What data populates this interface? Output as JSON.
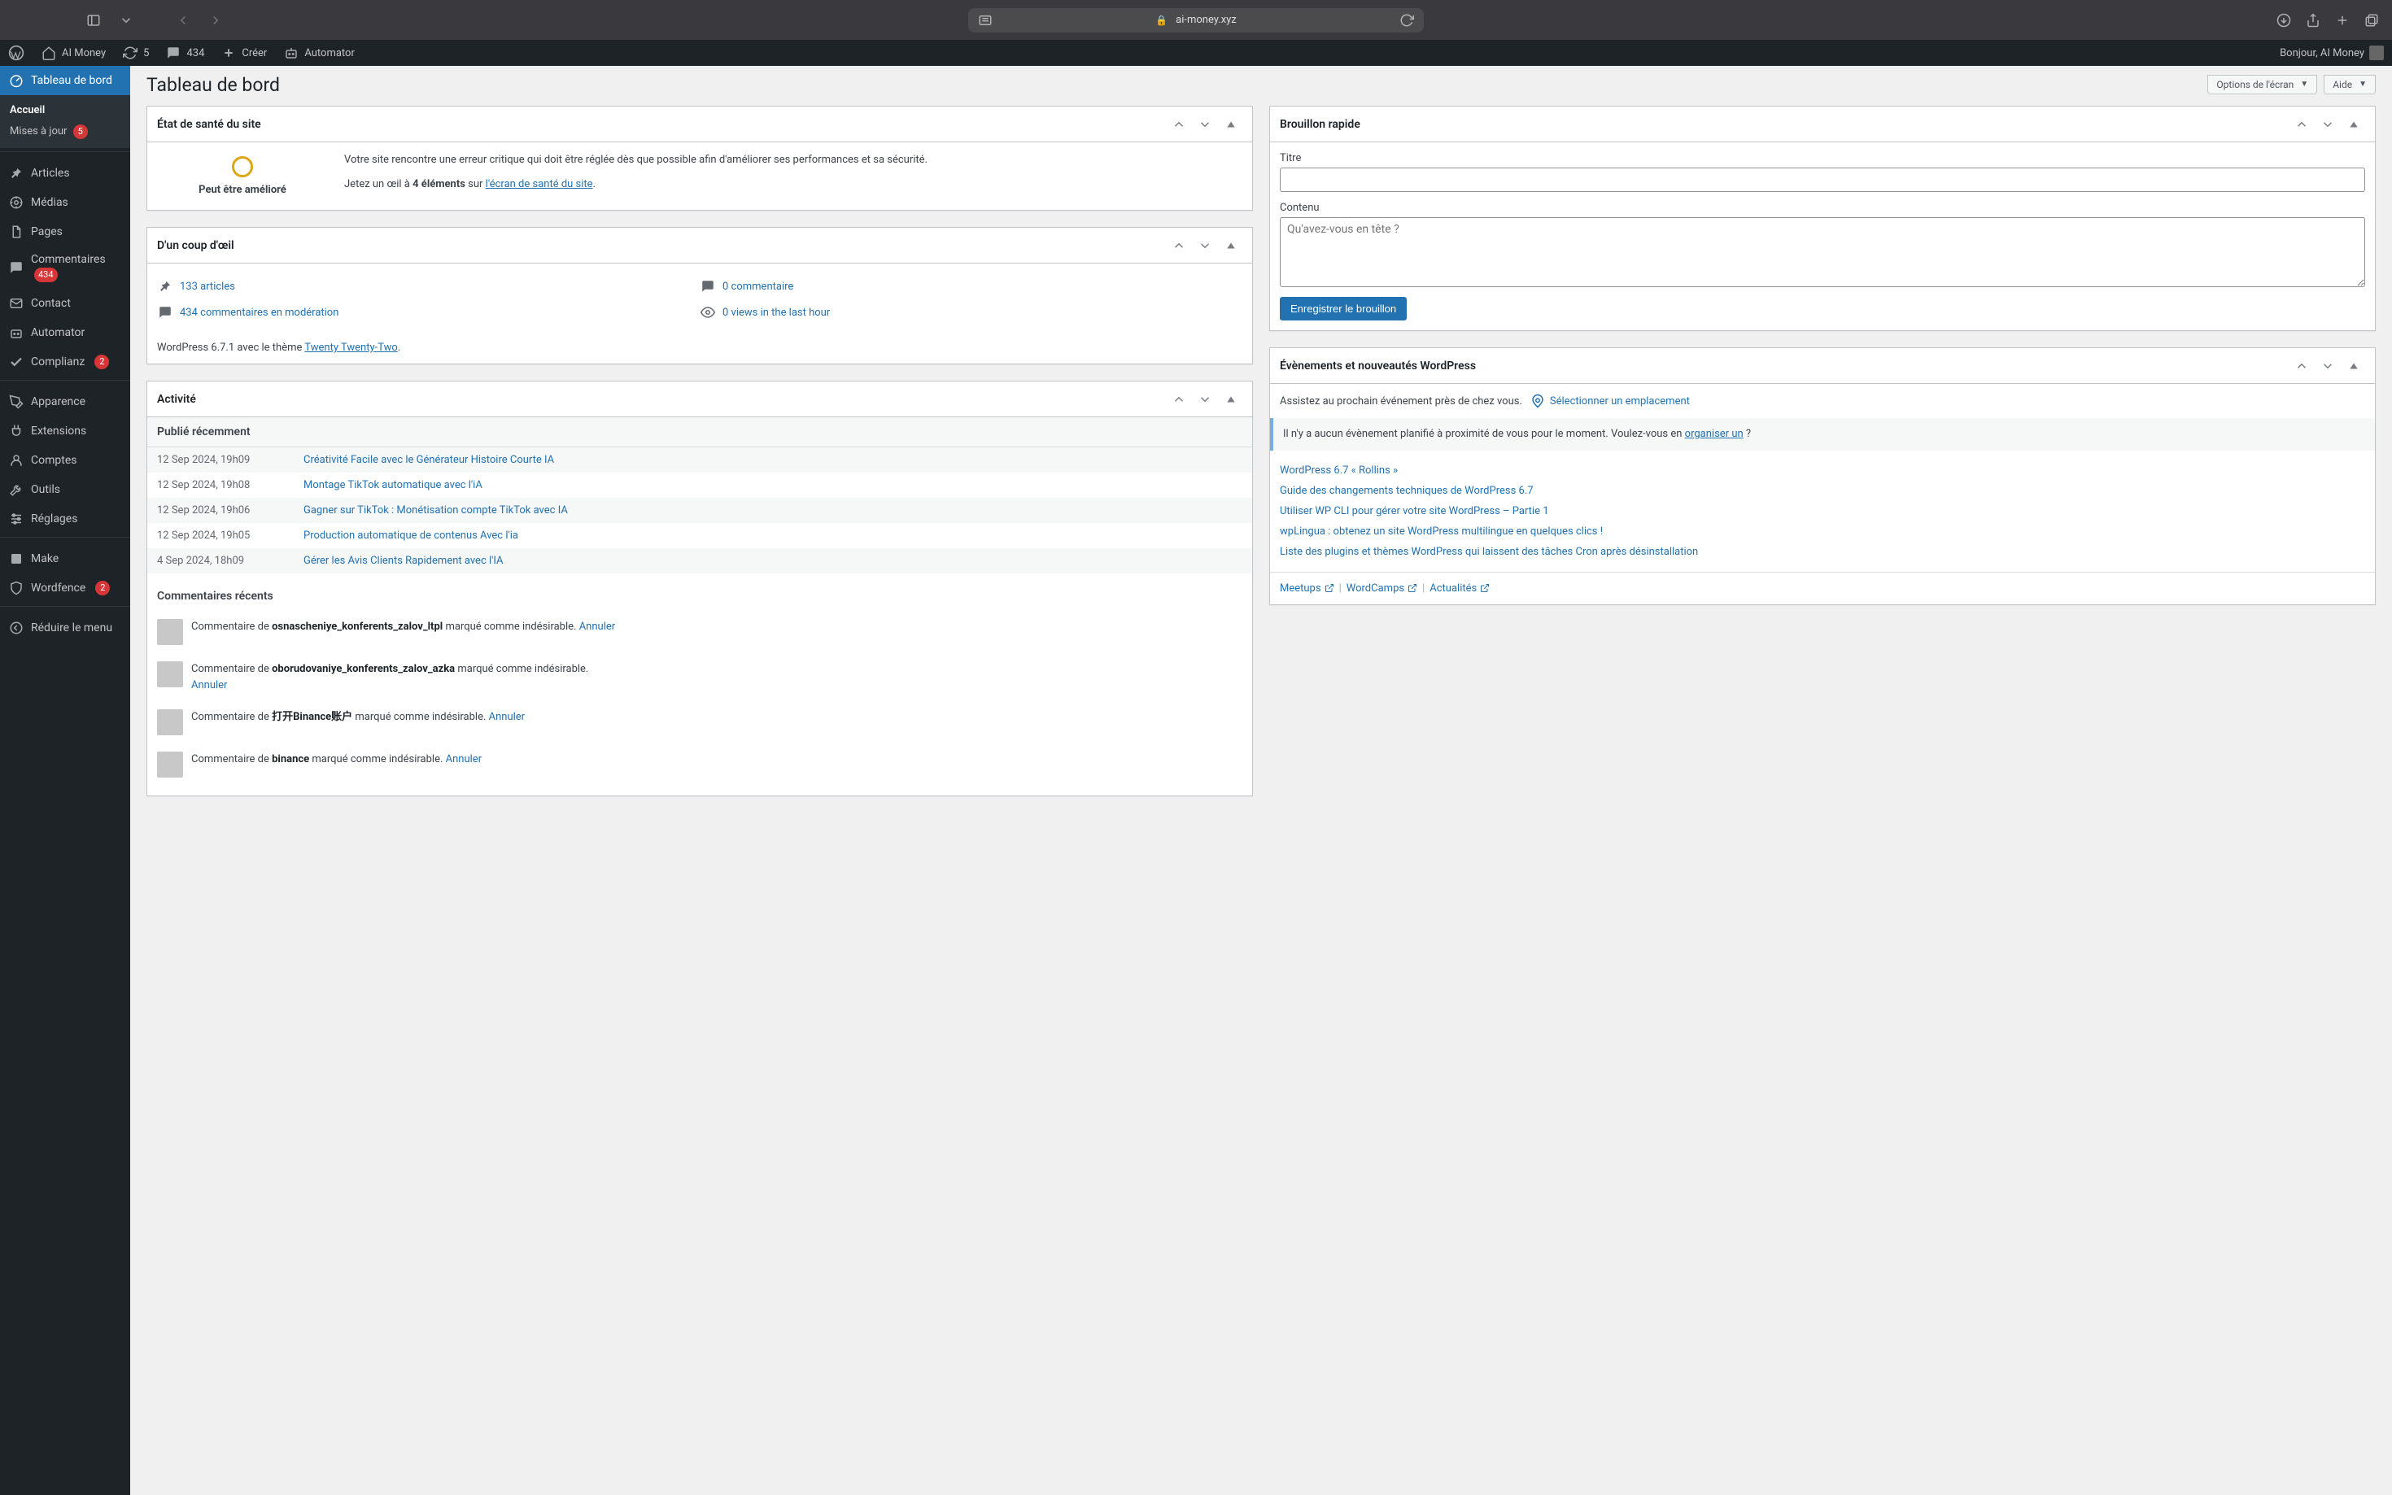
{
  "browser": {
    "url_host": "ai-money.xyz"
  },
  "adminbar": {
    "site_title": "AI Money",
    "refresh_count": "5",
    "comments_count": "434",
    "create": "Créer",
    "automator": "Automator",
    "howdy": "Bonjour, AI Money"
  },
  "sidebar": {
    "dashboard": "Tableau de bord",
    "home": "Accueil",
    "updates": "Mises à jour",
    "updates_badge": "5",
    "posts": "Articles",
    "media": "Médias",
    "pages": "Pages",
    "comments": "Commentaires",
    "comments_badge": "434",
    "contact": "Contact",
    "automator": "Automator",
    "complianz": "Complianz",
    "complianz_badge": "2",
    "appearance": "Apparence",
    "plugins": "Extensions",
    "users": "Comptes",
    "tools": "Outils",
    "settings": "Réglages",
    "make": "Make",
    "wordfence": "Wordfence",
    "wordfence_badge": "2",
    "collapse": "Réduire le menu"
  },
  "page": {
    "title": "Tableau de bord",
    "screen_options": "Options de l'écran",
    "help": "Aide"
  },
  "sitehealth": {
    "heading": "État de santé du site",
    "status_label": "Peut être amélioré",
    "body": "Votre site rencontre une erreur critique qui doit être réglée dès que possible afin d'améliorer ses performances et sa sécurité.",
    "cta_prefix": "Jetez un œil à ",
    "cta_bold": "4 éléments",
    "cta_mid": " sur ",
    "cta_link": "l'écran de santé du site"
  },
  "glance": {
    "heading": "D'un coup d'œil",
    "posts": "133 articles",
    "comments": "0 commentaire",
    "mod": "434 commentaires en modération",
    "views": "0 views in the last hour",
    "wp_prefix": "WordPress 6.7.1 avec le thème ",
    "theme": "Twenty Twenty-Two"
  },
  "activity": {
    "heading": "Activité",
    "recent_title": "Publié récemment",
    "posts": [
      {
        "date": "12 Sep 2024, 19h09",
        "title": "Créativité Facile avec le Générateur Histoire Courte IA"
      },
      {
        "date": "12 Sep 2024, 19h08",
        "title": "Montage TikTok automatique avec l'iA"
      },
      {
        "date": "12 Sep 2024, 19h06",
        "title": "Gagner sur TikTok : Monétisation compte TikTok avec IA"
      },
      {
        "date": "12 Sep 2024, 19h05",
        "title": "Production automatique de contenus Avec l'ia"
      },
      {
        "date": "4 Sep 2024, 18h09",
        "title": "Gérer les Avis Clients Rapidement avec l'IA"
      }
    ],
    "comments_title": "Commentaires récents",
    "comment_prefix": "Commentaire de ",
    "comment_suffix": " marqué comme indésirable. ",
    "cancel": "Annuler",
    "comments": [
      {
        "author": "osnascheniye_konferents_zalov_ltpl"
      },
      {
        "author": "oborudovaniye_konferents_zalov_azka"
      },
      {
        "author": "打开Binance账户"
      },
      {
        "author": "binance"
      }
    ]
  },
  "quickdraft": {
    "heading": "Brouillon rapide",
    "title_label": "Titre",
    "content_label": "Contenu",
    "content_placeholder": "Qu'avez-vous en tête ?",
    "save": "Enregistrer le brouillon"
  },
  "events": {
    "heading": "Évènements et nouveautés WordPress",
    "attend": "Assistez au prochain événement près de chez vous.",
    "select_location": "Sélectionner un emplacement",
    "none_prefix": "Il n'y a aucun évènement planifié à proximité de vous pour le moment. Voulez-vous en ",
    "organize": "organiser un",
    "qmark": " ?",
    "links": [
      "WordPress 6.7 « Rollins »",
      "Guide des changements techniques de WordPress 6.7",
      "Utiliser WP CLI pour gérer votre site WordPress – Partie 1",
      "wpLingua : obtenez un site WordPress multilingue en quelques clics !",
      "Liste des plugins et thèmes WordPress qui laissent des tâches Cron après désinstallation"
    ],
    "footer": {
      "meetups": "Meetups",
      "wordcamps": "WordCamps",
      "news": "Actualités"
    }
  }
}
